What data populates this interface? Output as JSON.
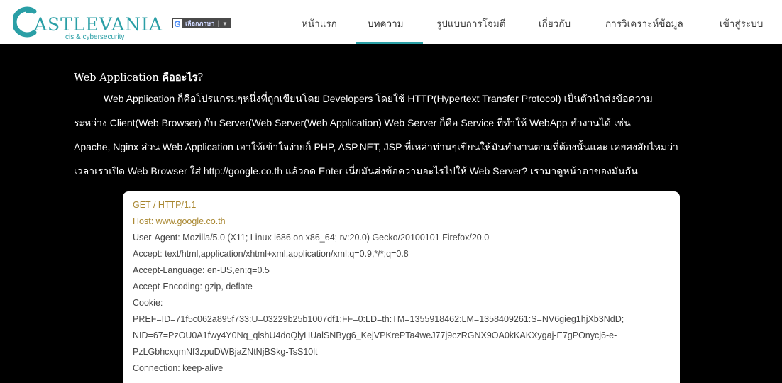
{
  "header": {
    "logo": {
      "text": "ASTLEVANIA",
      "letter": "C",
      "subtitle": "cis & cybersecurity",
      "color": "#2a9fa6"
    },
    "translate": {
      "icon": "G",
      "label": "เลือกภาษา",
      "separator": "|",
      "caret": "▼"
    },
    "nav": [
      {
        "label": "หน้าแรก",
        "active": false
      },
      {
        "label": "บทความ",
        "active": true
      },
      {
        "label": "รูปแบบการโจมตี",
        "active": false
      },
      {
        "label": "เกี่ยวกับ",
        "active": false
      },
      {
        "label": "การวิเคราะห์ข้อมูล",
        "active": false
      },
      {
        "label": "เข้าสู่ระบบ",
        "active": false
      }
    ],
    "accent": "#2a9fa6"
  },
  "article": {
    "title_prefix": "Web Application",
    "title_bold": "คืออะไร",
    "title_suffix": "?",
    "lines": [
      "Web Application ก็คือโปรแกรมๆหนึ่งที่ถูกเขียนโดย Developers โดยใช้ HTTP(Hypertext Transfer Protocol) เป็นตัวนำส่งข้อความ",
      "ระหว่าง Client(Web Browser) กับ Server(Web Server(Web Application) Web Server ก็คือ Service ที่ทำให้ WebApp ทำงานได้ เช่น",
      "Apache, Nginx ส่วน Web Application เอาให้เข้าใจง่ายก็ PHP, ASP.NET, JSP ที่เหล่าท่านๆเขียนให้มันทำงานตามที่ต้องนั้นและ เคยสงสัยไหมว่า",
      "เวลาเราเปิด Web Browser ใส่ http://google.co.th แล้วกด Enter เนี่ยมันส่งข้อความอะไรไปให้ Web Server? เรามาดูหน้าตาของมันกัน"
    ]
  },
  "code": {
    "highlight_color": "#a8862f",
    "lines": [
      "GET / HTTP/1.1",
      "Host: www.google.co.th",
      "User-Agent: Mozilla/5.0 (X11; Linux i686 on x86_64; rv:20.0) Gecko/20100101 Firefox/20.0",
      "Accept: text/html,application/xhtml+xml,application/xml;q=0.9,*/*;q=0.8",
      "Accept-Language: en-US,en;q=0.5",
      "Accept-Encoding: gzip, deflate",
      "Cookie:",
      "PREF=ID=71f5c062a895f733:U=03229b25b1007df1:FF=0:LD=th:TM=1355918462:LM=1358409261:S=NV6gieg1hjXb3NdD;",
      "NID=67=PzOU0A1fwy4Y0Nq_qlshU4doQlyHUalSNByg6_KejVPKrePTa4weJ77j9czRGNX9OA0kKAKXygaj-E7gPOnycj6-e-",
      "PzLGbhcxqmNf3zpuDWBjaZNtNjBSkg-TsS10lt",
      "Connection: keep-alive"
    ]
  }
}
